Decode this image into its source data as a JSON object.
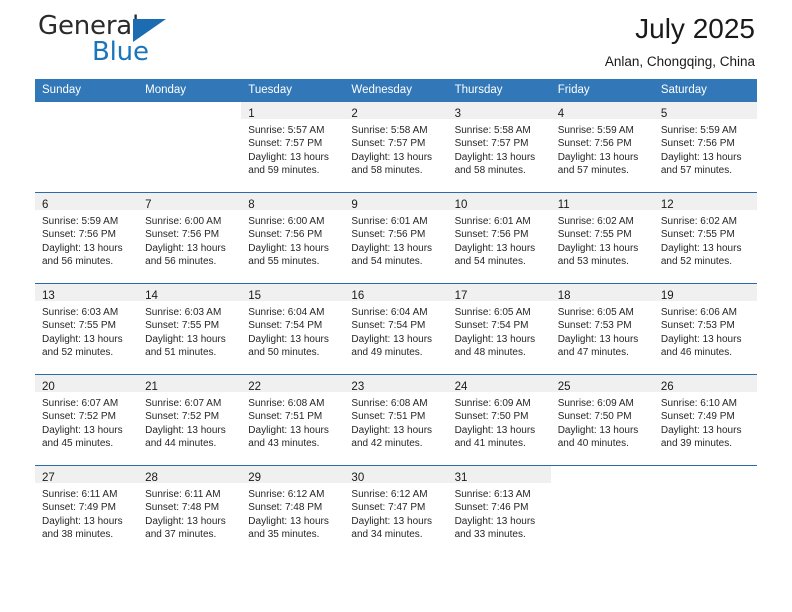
{
  "brand": {
    "name_part1": "General",
    "name_part2": "Blue",
    "accent_color": "#1b75bc",
    "triangle_color": "#1b6cb0"
  },
  "header": {
    "month_title": "July 2025",
    "location": "Anlan, Chongqing, China"
  },
  "theme": {
    "header_row_color": "#3277b8",
    "week_separator_color": "#2b6ca8",
    "daynum_band_color": "#f0f0f0"
  },
  "weekday_headers": [
    "Sunday",
    "Monday",
    "Tuesday",
    "Wednesday",
    "Thursday",
    "Friday",
    "Saturday"
  ],
  "weeks": [
    [
      {
        "day": "",
        "sunrise": "",
        "sunset": "",
        "daylight_line1": "",
        "daylight_line2": "",
        "empty": true
      },
      {
        "day": "",
        "sunrise": "",
        "sunset": "",
        "daylight_line1": "",
        "daylight_line2": "",
        "empty": true
      },
      {
        "day": "1",
        "sunrise": "Sunrise: 5:57 AM",
        "sunset": "Sunset: 7:57 PM",
        "daylight_line1": "Daylight: 13 hours",
        "daylight_line2": "and 59 minutes."
      },
      {
        "day": "2",
        "sunrise": "Sunrise: 5:58 AM",
        "sunset": "Sunset: 7:57 PM",
        "daylight_line1": "Daylight: 13 hours",
        "daylight_line2": "and 58 minutes."
      },
      {
        "day": "3",
        "sunrise": "Sunrise: 5:58 AM",
        "sunset": "Sunset: 7:57 PM",
        "daylight_line1": "Daylight: 13 hours",
        "daylight_line2": "and 58 minutes."
      },
      {
        "day": "4",
        "sunrise": "Sunrise: 5:59 AM",
        "sunset": "Sunset: 7:56 PM",
        "daylight_line1": "Daylight: 13 hours",
        "daylight_line2": "and 57 minutes."
      },
      {
        "day": "5",
        "sunrise": "Sunrise: 5:59 AM",
        "sunset": "Sunset: 7:56 PM",
        "daylight_line1": "Daylight: 13 hours",
        "daylight_line2": "and 57 minutes."
      }
    ],
    [
      {
        "day": "6",
        "sunrise": "Sunrise: 5:59 AM",
        "sunset": "Sunset: 7:56 PM",
        "daylight_line1": "Daylight: 13 hours",
        "daylight_line2": "and 56 minutes."
      },
      {
        "day": "7",
        "sunrise": "Sunrise: 6:00 AM",
        "sunset": "Sunset: 7:56 PM",
        "daylight_line1": "Daylight: 13 hours",
        "daylight_line2": "and 56 minutes."
      },
      {
        "day": "8",
        "sunrise": "Sunrise: 6:00 AM",
        "sunset": "Sunset: 7:56 PM",
        "daylight_line1": "Daylight: 13 hours",
        "daylight_line2": "and 55 minutes."
      },
      {
        "day": "9",
        "sunrise": "Sunrise: 6:01 AM",
        "sunset": "Sunset: 7:56 PM",
        "daylight_line1": "Daylight: 13 hours",
        "daylight_line2": "and 54 minutes."
      },
      {
        "day": "10",
        "sunrise": "Sunrise: 6:01 AM",
        "sunset": "Sunset: 7:56 PM",
        "daylight_line1": "Daylight: 13 hours",
        "daylight_line2": "and 54 minutes."
      },
      {
        "day": "11",
        "sunrise": "Sunrise: 6:02 AM",
        "sunset": "Sunset: 7:55 PM",
        "daylight_line1": "Daylight: 13 hours",
        "daylight_line2": "and 53 minutes."
      },
      {
        "day": "12",
        "sunrise": "Sunrise: 6:02 AM",
        "sunset": "Sunset: 7:55 PM",
        "daylight_line1": "Daylight: 13 hours",
        "daylight_line2": "and 52 minutes."
      }
    ],
    [
      {
        "day": "13",
        "sunrise": "Sunrise: 6:03 AM",
        "sunset": "Sunset: 7:55 PM",
        "daylight_line1": "Daylight: 13 hours",
        "daylight_line2": "and 52 minutes."
      },
      {
        "day": "14",
        "sunrise": "Sunrise: 6:03 AM",
        "sunset": "Sunset: 7:55 PM",
        "daylight_line1": "Daylight: 13 hours",
        "daylight_line2": "and 51 minutes."
      },
      {
        "day": "15",
        "sunrise": "Sunrise: 6:04 AM",
        "sunset": "Sunset: 7:54 PM",
        "daylight_line1": "Daylight: 13 hours",
        "daylight_line2": "and 50 minutes."
      },
      {
        "day": "16",
        "sunrise": "Sunrise: 6:04 AM",
        "sunset": "Sunset: 7:54 PM",
        "daylight_line1": "Daylight: 13 hours",
        "daylight_line2": "and 49 minutes."
      },
      {
        "day": "17",
        "sunrise": "Sunrise: 6:05 AM",
        "sunset": "Sunset: 7:54 PM",
        "daylight_line1": "Daylight: 13 hours",
        "daylight_line2": "and 48 minutes."
      },
      {
        "day": "18",
        "sunrise": "Sunrise: 6:05 AM",
        "sunset": "Sunset: 7:53 PM",
        "daylight_line1": "Daylight: 13 hours",
        "daylight_line2": "and 47 minutes."
      },
      {
        "day": "19",
        "sunrise": "Sunrise: 6:06 AM",
        "sunset": "Sunset: 7:53 PM",
        "daylight_line1": "Daylight: 13 hours",
        "daylight_line2": "and 46 minutes."
      }
    ],
    [
      {
        "day": "20",
        "sunrise": "Sunrise: 6:07 AM",
        "sunset": "Sunset: 7:52 PM",
        "daylight_line1": "Daylight: 13 hours",
        "daylight_line2": "and 45 minutes."
      },
      {
        "day": "21",
        "sunrise": "Sunrise: 6:07 AM",
        "sunset": "Sunset: 7:52 PM",
        "daylight_line1": "Daylight: 13 hours",
        "daylight_line2": "and 44 minutes."
      },
      {
        "day": "22",
        "sunrise": "Sunrise: 6:08 AM",
        "sunset": "Sunset: 7:51 PM",
        "daylight_line1": "Daylight: 13 hours",
        "daylight_line2": "and 43 minutes."
      },
      {
        "day": "23",
        "sunrise": "Sunrise: 6:08 AM",
        "sunset": "Sunset: 7:51 PM",
        "daylight_line1": "Daylight: 13 hours",
        "daylight_line2": "and 42 minutes."
      },
      {
        "day": "24",
        "sunrise": "Sunrise: 6:09 AM",
        "sunset": "Sunset: 7:50 PM",
        "daylight_line1": "Daylight: 13 hours",
        "daylight_line2": "and 41 minutes."
      },
      {
        "day": "25",
        "sunrise": "Sunrise: 6:09 AM",
        "sunset": "Sunset: 7:50 PM",
        "daylight_line1": "Daylight: 13 hours",
        "daylight_line2": "and 40 minutes."
      },
      {
        "day": "26",
        "sunrise": "Sunrise: 6:10 AM",
        "sunset": "Sunset: 7:49 PM",
        "daylight_line1": "Daylight: 13 hours",
        "daylight_line2": "and 39 minutes."
      }
    ],
    [
      {
        "day": "27",
        "sunrise": "Sunrise: 6:11 AM",
        "sunset": "Sunset: 7:49 PM",
        "daylight_line1": "Daylight: 13 hours",
        "daylight_line2": "and 38 minutes."
      },
      {
        "day": "28",
        "sunrise": "Sunrise: 6:11 AM",
        "sunset": "Sunset: 7:48 PM",
        "daylight_line1": "Daylight: 13 hours",
        "daylight_line2": "and 37 minutes."
      },
      {
        "day": "29",
        "sunrise": "Sunrise: 6:12 AM",
        "sunset": "Sunset: 7:48 PM",
        "daylight_line1": "Daylight: 13 hours",
        "daylight_line2": "and 35 minutes."
      },
      {
        "day": "30",
        "sunrise": "Sunrise: 6:12 AM",
        "sunset": "Sunset: 7:47 PM",
        "daylight_line1": "Daylight: 13 hours",
        "daylight_line2": "and 34 minutes."
      },
      {
        "day": "31",
        "sunrise": "Sunrise: 6:13 AM",
        "sunset": "Sunset: 7:46 PM",
        "daylight_line1": "Daylight: 13 hours",
        "daylight_line2": "and 33 minutes."
      },
      {
        "day": "",
        "sunrise": "",
        "sunset": "",
        "daylight_line1": "",
        "daylight_line2": "",
        "empty": true
      },
      {
        "day": "",
        "sunrise": "",
        "sunset": "",
        "daylight_line1": "",
        "daylight_line2": "",
        "empty": true
      }
    ]
  ]
}
